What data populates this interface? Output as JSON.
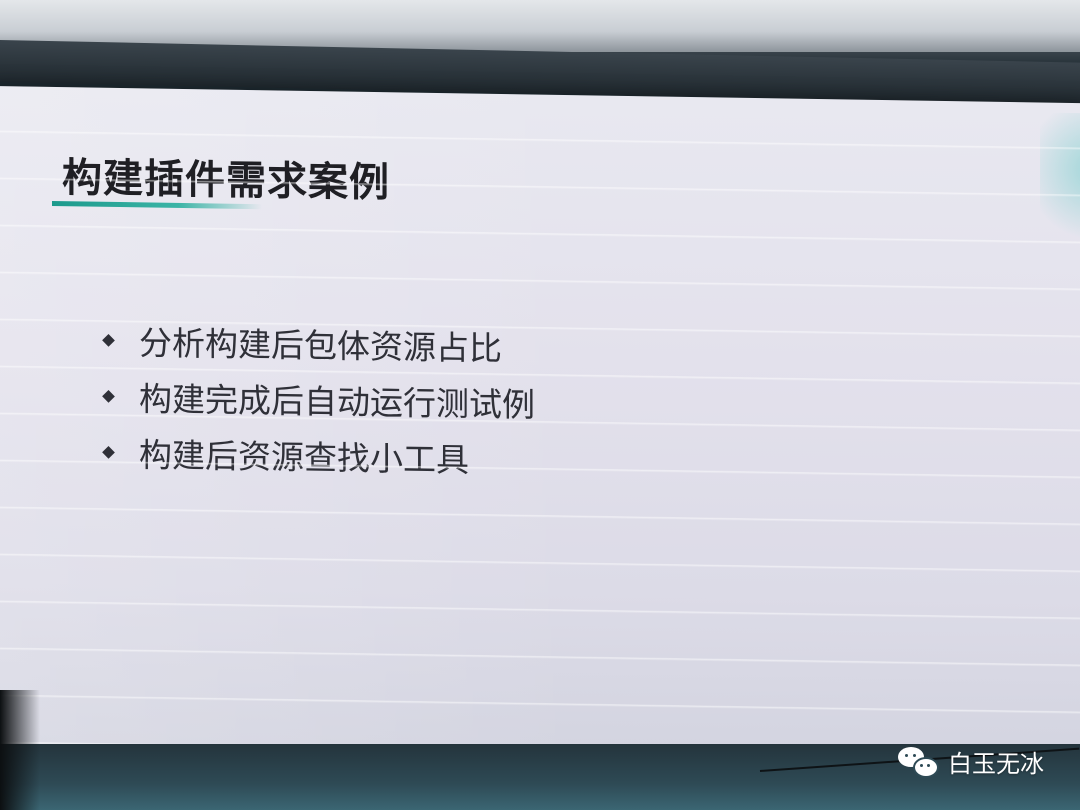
{
  "slide": {
    "title": "构建插件需求案例",
    "bullets": [
      "分析构建后包体资源占比",
      "构建完成后自动运行测试例",
      "构建后资源查找小工具"
    ],
    "accent_color": "#1c9a8c"
  },
  "watermark": {
    "text": "白玉无冰",
    "icon": "wechat-icon"
  }
}
